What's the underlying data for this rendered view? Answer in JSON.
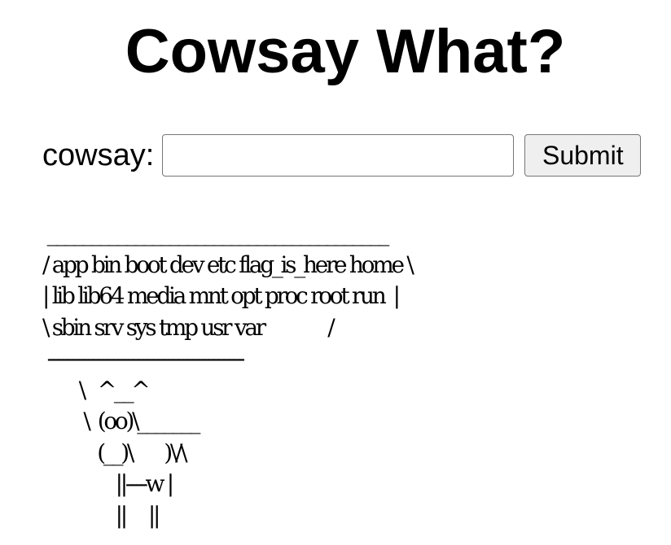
{
  "page": {
    "title": "Cowsay What?"
  },
  "form": {
    "label": "cowsay:",
    "input_value": "",
    "submit_label": "Submit"
  },
  "output": {
    "text": " _______________________________________\n/ app bin boot dev etc flag_is_here home \\\n| lib lib64 media mnt opt proc root run  |\n\\ sbin srv sys tmp usr var              /\n ---------------------------------------\n        \\   ^__^\n         \\  (oo)\\_______\n            (__)\\       )\\/\\\n                ||----w |\n                ||     ||"
  }
}
